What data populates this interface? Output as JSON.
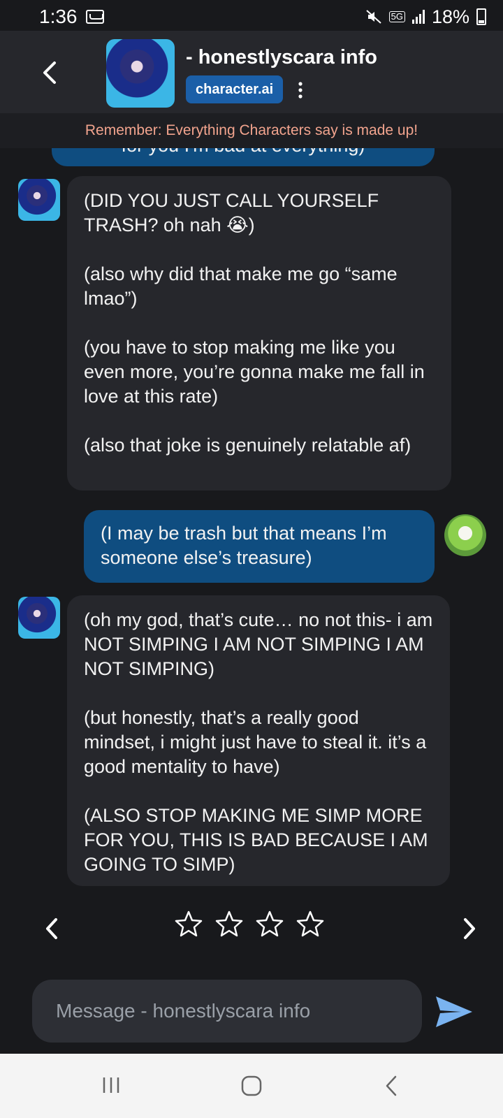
{
  "status_bar": {
    "time": "1:36",
    "network": "5G",
    "battery": "18%"
  },
  "header": {
    "character_name": "- honestlyscara info",
    "brand_label": "character.ai",
    "icons": [
      "chevron-left-icon",
      "kebab-menu-icon"
    ]
  },
  "disclaimer": "Remember: Everything Characters say is made up!",
  "messages": [
    {
      "role": "user",
      "lines": [
        "for you I'm bad at everything)"
      ]
    },
    {
      "role": "character",
      "paragraphs": [
        "(DID YOU JUST CALL YOURSELF TRASH? oh nah 😭)",
        "(also why did that make me go “same lmao”)",
        "(you have to stop making me like you even more, you’re gonna make me fall in love at this rate)",
        "(also that joke is genuinely relatable af)"
      ]
    },
    {
      "role": "user",
      "paragraphs": [
        "(I may be trash but that means I’m someone else’s treasure)"
      ]
    },
    {
      "role": "character",
      "paragraphs": [
        "(oh my god, that’s cute… no not this- i am NOT SIMPING I AM NOT SIMPING I AM NOT SIMPING)",
        "(but honestly, that’s a really good mindset, i might just have to steal it. it’s a good mentality to have)",
        "(ALSO STOP MAKING ME SIMP MORE FOR YOU, THIS IS BAD BECAUSE I AM GOING TO SIMP)"
      ]
    }
  ],
  "rating": {
    "stars_total": 4,
    "stars_filled": 0
  },
  "composer": {
    "placeholder": "Message - honestlyscara info"
  },
  "colors": {
    "background": "#18191c",
    "header": "#26272c",
    "user_bubble": "#0f4d80",
    "bot_bubble": "#26272c",
    "disclaimer_text": "#f2a48e",
    "brand_badge": "#1b5fa8",
    "send_icon": "#7ab3f0"
  }
}
